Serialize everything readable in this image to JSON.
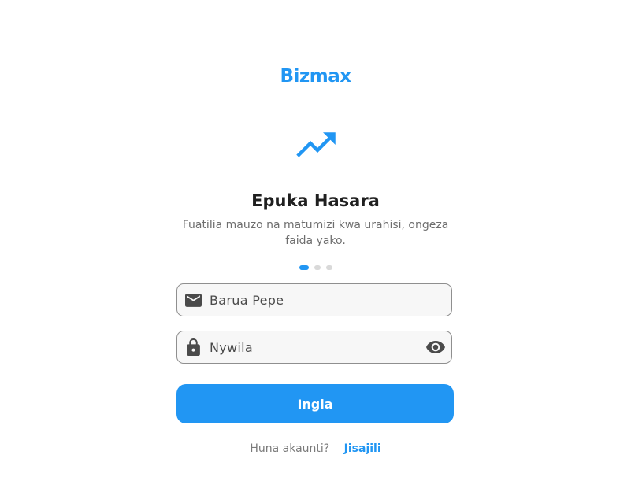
{
  "brand": {
    "name": "Bizmax"
  },
  "onboarding": {
    "icon": "trending-up-icon",
    "title": "Epuka Hasara",
    "description": "Fuatilia mauzo na matumizi kwa urahisi, ongeza faida yako.",
    "pages": 3,
    "active_page": 1
  },
  "form": {
    "email_placeholder": "Barua Pepe",
    "email_icon": "mail-icon",
    "password_placeholder": "Nywila",
    "password_icon": "lock-icon",
    "password_toggle_icon": "eye-icon",
    "submit_label": "Ingia"
  },
  "signup": {
    "prompt": "Huna akaunti?",
    "link_label": "Jisajili"
  },
  "colors": {
    "primary": "#2196f3",
    "title_text": "#1f1f1f",
    "muted_text": "#6e6e6e",
    "field_border": "#8f8f8f",
    "field_bg": "#f7f7f7",
    "dot_inactive": "#d9d9d9"
  }
}
